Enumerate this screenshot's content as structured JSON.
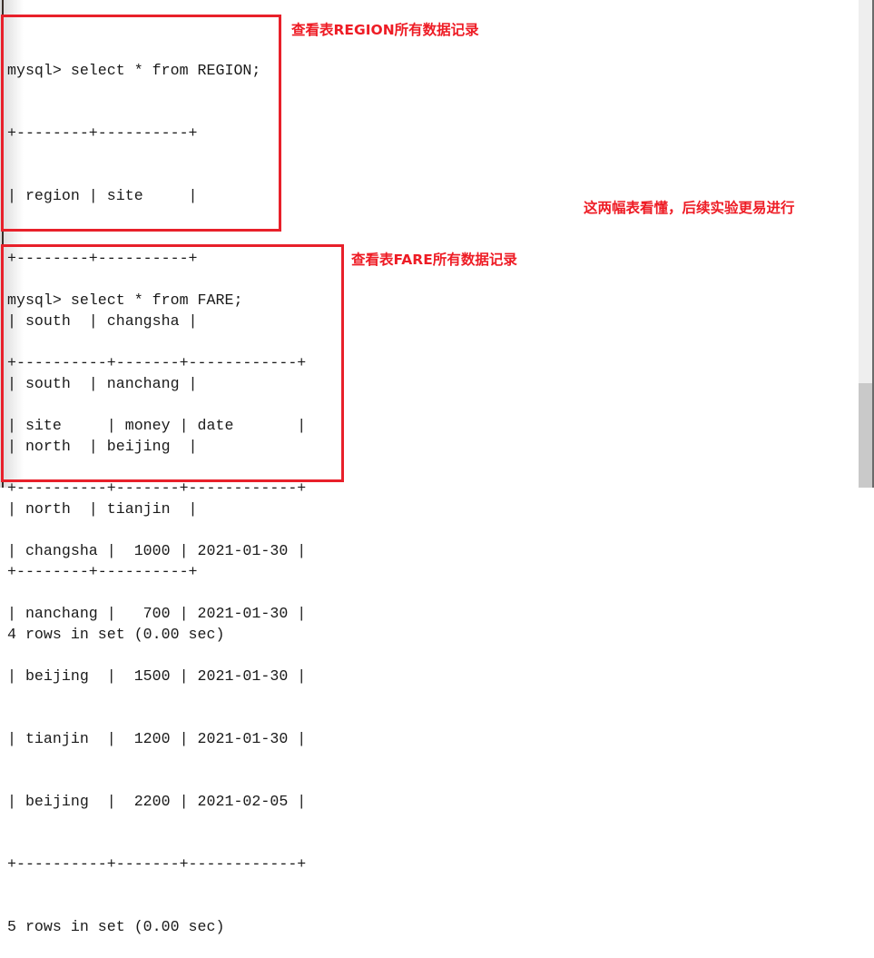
{
  "terminal": {
    "region_query": {
      "prompt": "mysql> select * from REGION;",
      "table_lines": [
        "+--------+----------+",
        "| region | site     |",
        "+--------+----------+",
        "| south  | changsha |",
        "| south  | nanchang |",
        "| north  | beijing  |",
        "| north  | tianjin  |",
        "+--------+----------+"
      ],
      "columns": [
        "region",
        "site"
      ],
      "rows": [
        [
          "south",
          "changsha"
        ],
        [
          "south",
          "nanchang"
        ],
        [
          "north",
          "beijing"
        ],
        [
          "north",
          "tianjin"
        ]
      ],
      "footer": "4 rows in set (0.00 sec)"
    },
    "fare_query": {
      "prompt": "mysql> select * from FARE;",
      "table_lines": [
        "+----------+-------+------------+",
        "| site     | money | date       |",
        "+----------+-------+------------+",
        "| changsha |  1000 | 2021-01-30 |",
        "| nanchang |   700 | 2021-01-30 |",
        "| beijing  |  1500 | 2021-01-30 |",
        "| tianjin  |  1200 | 2021-01-30 |",
        "| beijing  |  2200 | 2021-02-05 |",
        "+----------+-------+------------+"
      ],
      "columns": [
        "site",
        "money",
        "date"
      ],
      "rows": [
        [
          "changsha",
          "1000",
          "2021-01-30"
        ],
        [
          "nanchang",
          "700",
          "2021-01-30"
        ],
        [
          "beijing",
          "1500",
          "2021-01-30"
        ],
        [
          "tianjin",
          "1200",
          "2021-01-30"
        ],
        [
          "beijing",
          "2200",
          "2021-02-05"
        ]
      ],
      "footer": "5 rows in set (0.00 sec)"
    }
  },
  "annotations": {
    "region_note": "查看表REGION所有数据记录",
    "summary_note": "这两幅表看懂，后续实验更易进行",
    "fare_note": "查看表FARE所有数据记录"
  },
  "colors": {
    "highlight_red": "#e8202a",
    "annotation_red": "#ee1c25",
    "terminal_text": "#1a1a1a",
    "background": "#ffffff"
  }
}
